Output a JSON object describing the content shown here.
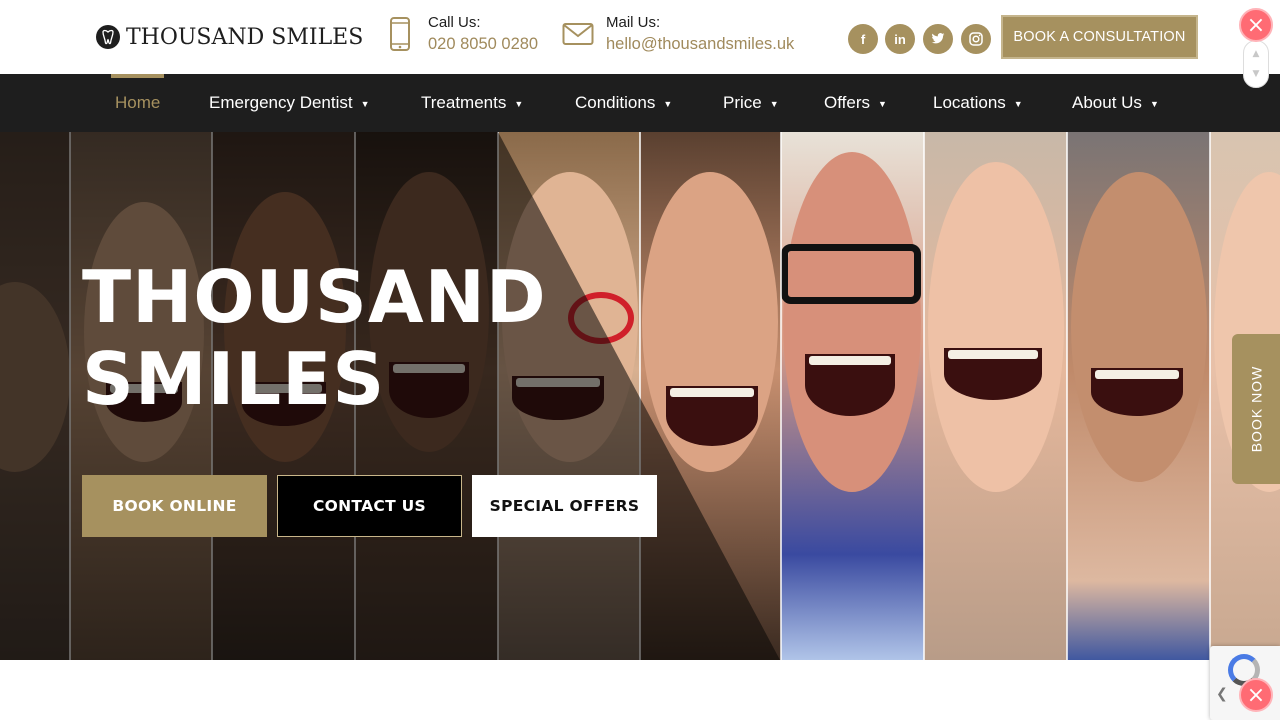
{
  "header": {
    "logo_text": "THOUSAND SMILES",
    "phone_title": "Call Us:",
    "phone_value": "020 8050 0280",
    "mail_title": "Mail Us:",
    "mail_value": "hello@thousandsmiles.uk",
    "social": [
      {
        "name": "facebook-icon",
        "glyph": "f"
      },
      {
        "name": "linkedin-icon",
        "glyph": "in"
      },
      {
        "name": "twitter-icon",
        "glyph": "t"
      },
      {
        "name": "instagram-icon",
        "glyph": "◎"
      }
    ],
    "consult_label": "BOOK A CONSULTATION"
  },
  "nav": {
    "items": [
      {
        "label": "Home",
        "active": true,
        "has_menu": false
      },
      {
        "label": "Emergency Dentist",
        "active": false,
        "has_menu": true
      },
      {
        "label": "Treatments",
        "active": false,
        "has_menu": true
      },
      {
        "label": "Conditions",
        "active": false,
        "has_menu": true
      },
      {
        "label": "Price",
        "active": false,
        "has_menu": true
      },
      {
        "label": "Offers",
        "active": false,
        "has_menu": true
      },
      {
        "label": "Locations",
        "active": false,
        "has_menu": true
      },
      {
        "label": "About Us",
        "active": false,
        "has_menu": true
      }
    ]
  },
  "hero": {
    "title_line1": "THOUSAND",
    "title_line2": "SMILES",
    "buttons": {
      "book": "BOOK ONLINE",
      "contact": "CONTACT US",
      "offers": "SPECIAL OFFERS"
    }
  },
  "widgets": {
    "book_now_label": "BOOK NOW",
    "close_glyph": "×"
  },
  "colors": {
    "accent": "#a6915f",
    "nav_bg": "#1e1e1e",
    "close_fab": "#ff6b74"
  }
}
